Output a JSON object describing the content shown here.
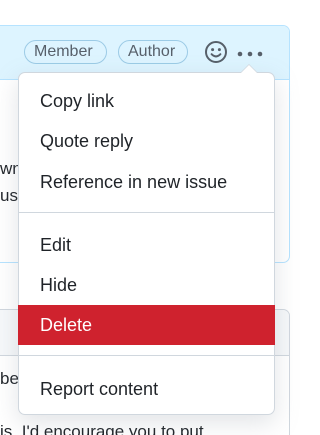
{
  "comment_header": {
    "badges": [
      "Member",
      "Author"
    ],
    "emoji_icon": "smiley-icon",
    "more_icon": "kebab-horizontal-icon"
  },
  "comment_body_fragments": [
    "wn",
    "us"
  ],
  "next_comment_body_fragments": [
    "beg",
    "is. I'd encourage you to put"
  ],
  "menu": {
    "items": [
      {
        "label": "Copy link"
      },
      {
        "label": "Quote reply"
      },
      {
        "label": "Reference in new issue"
      },
      {
        "label": "Edit"
      },
      {
        "label": "Hide"
      },
      {
        "label": "Delete",
        "style": "danger",
        "highlighted": true
      },
      {
        "label": "Report content"
      }
    ]
  },
  "colors": {
    "header_bg": "#ddf4ff",
    "header_border": "#b6e3ff",
    "danger": "#cf222e",
    "text": "#1f2328",
    "muted": "#57606a"
  }
}
